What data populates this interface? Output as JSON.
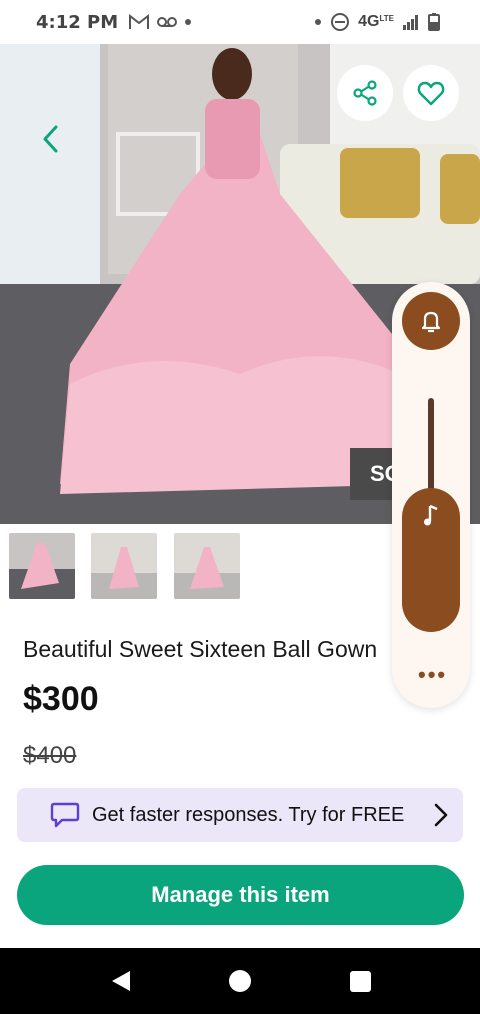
{
  "status_bar": {
    "time": "4:12 PM",
    "network": "4G",
    "network_sub": "LTE",
    "left_icons": [
      "gmail-icon",
      "voicemail-icon",
      "dot-icon"
    ],
    "right_icons": [
      "dot-icon",
      "dnd-icon",
      "signal-icon",
      "battery-icon"
    ]
  },
  "hero": {
    "sold_tag": "SO",
    "back_icon": "chevron-left-icon",
    "share_icon": "share-icon",
    "favorite_icon": "heart-icon"
  },
  "volume_panel": {
    "bell_icon": "bell-icon",
    "media_icon": "music-note-icon",
    "more_label": "•••",
    "media_level": 0.5
  },
  "thumbnails": [
    "thumbnail-1",
    "thumbnail-2",
    "thumbnail-3"
  ],
  "listing": {
    "title": "Beautiful Sweet  Sixteen Ball Gown",
    "price": "$300",
    "original_price": "$400"
  },
  "promo": {
    "text": "Get faster responses. Try for FREE",
    "icon": "chat-bubble-icon"
  },
  "actions": {
    "manage_label": "Manage this item"
  },
  "colors": {
    "accent_green": "#0aa57c",
    "promo_bg": "#ebe6f8",
    "volume_brown": "#8b4c20"
  }
}
